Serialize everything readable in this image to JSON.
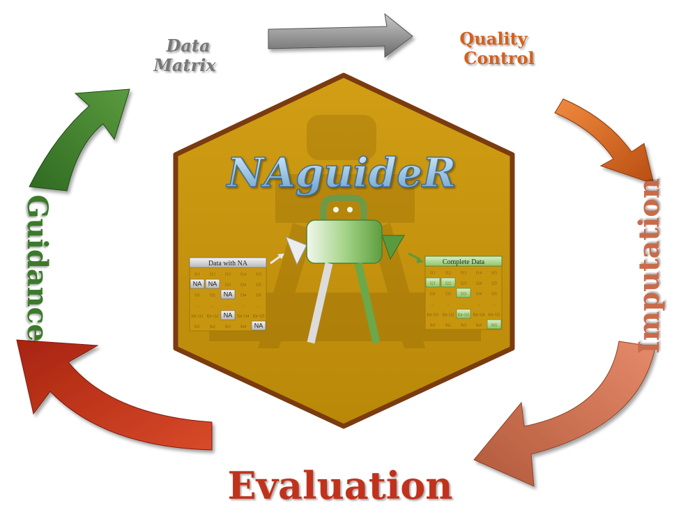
{
  "logo_title": "NAguideR",
  "cycle": {
    "data_matrix": [
      "Data",
      "Matrix"
    ],
    "quality_control": [
      "Quality",
      "Control"
    ],
    "imputation": "Imputation",
    "evaluation": "Evaluation",
    "guidance": "Guidance"
  },
  "left_table": {
    "title": "Data with NA",
    "rows": [
      [
        "I11",
        "I12",
        "I13",
        "I14",
        "I15"
      ],
      [
        "NA",
        "NA",
        "I23",
        "I24",
        "I25"
      ],
      [
        "I31",
        "I32",
        "NA",
        "I34",
        "I35"
      ],
      [
        "...",
        "...",
        "...",
        "...",
        "..."
      ],
      [
        "I(n-1)1",
        "I(n-1)2",
        "NA",
        "I(n-1)4",
        "I(n-1)5"
      ],
      [
        "In1",
        "In2",
        "In3",
        "In4",
        "NA"
      ]
    ]
  },
  "right_table": {
    "title": "Complete Data",
    "rows": [
      [
        "I11",
        "I12",
        "I13",
        "I14",
        "I15"
      ],
      [
        "I21",
        "I22",
        "I23",
        "I24",
        "I25"
      ],
      [
        "I31",
        "I32",
        "I33",
        "I34",
        "I35"
      ],
      [
        "...",
        "...",
        "...",
        "...",
        "..."
      ],
      [
        "I(n-1)1",
        "I(n-1)2",
        "I(n-1)3",
        "I(n-1)4",
        "I(n-1)5"
      ],
      [
        "In1",
        "In2",
        "In3",
        "In4",
        "In5"
      ]
    ],
    "imputed_cells": [
      [
        1,
        0
      ],
      [
        1,
        1
      ],
      [
        2,
        2
      ],
      [
        4,
        2
      ],
      [
        5,
        4
      ]
    ]
  },
  "colors": {
    "hexagon_fill": "#c8960e",
    "hexagon_border": "#7a3b10",
    "guidance_green": "#3a7a2a",
    "data_matrix_gray": "#6e6e6e",
    "quality_orange": "#d4601e",
    "imputation_salmon": "#c96a4a",
    "evaluation_red": "#c0301a",
    "logo_blue": "#7ab0d8",
    "tool_green": "#7cba5a"
  }
}
